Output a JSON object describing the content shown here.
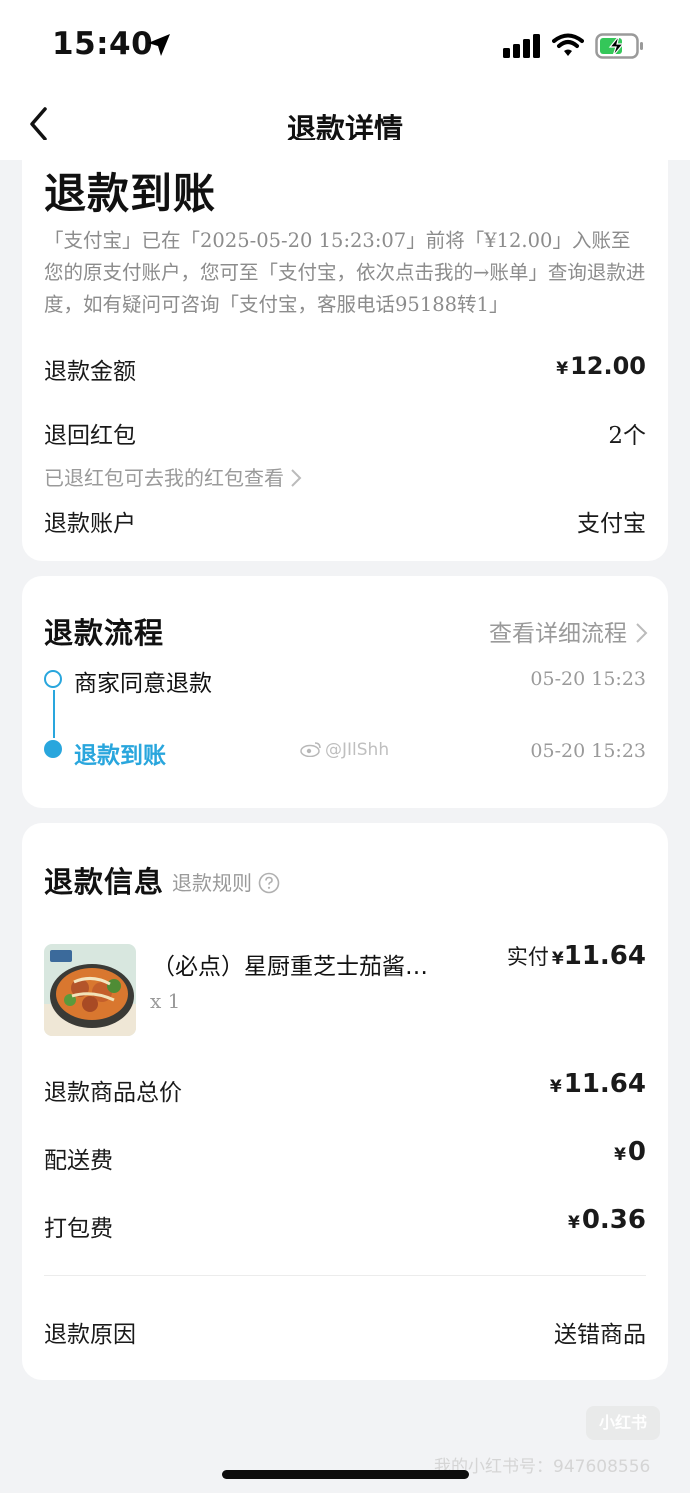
{
  "status_bar": {
    "time": "15:40"
  },
  "nav": {
    "title": "退款详情"
  },
  "summary": {
    "title": "退款到账",
    "notice": "「支付宝」已在「2025-05-20 15:23:07」前将「¥12.00」入账至您的原支付账户，您可至「支付宝，依次点击我的→账单」查询退款进度，如有疑问可咨询「支付宝，客服电话95188转1」",
    "refund_amount_label": "退款金额",
    "refund_amount_currency": "¥",
    "refund_amount_value": "12.00",
    "red_packet_label": "退回红包",
    "red_packet_value": "2个",
    "red_packet_hint": "已退红包可去我的红包查看",
    "account_label": "退款账户",
    "account_value": "支付宝"
  },
  "process": {
    "title": "退款流程",
    "detail_link": "查看详细流程",
    "steps": [
      {
        "label": "商家同意退款",
        "time": "05-20 15:23"
      },
      {
        "label": "退款到账",
        "time": "05-20 15:23"
      }
    ]
  },
  "info": {
    "title": "退款信息",
    "rules_link": "退款规则",
    "item": {
      "name": "（必点）星厨重芝士茄酱…",
      "qty": "x 1",
      "paid_label": "实付",
      "currency": "¥",
      "paid_value": "11.64"
    },
    "rows": [
      {
        "label": "退款商品总价",
        "currency": "¥",
        "value": "11.64"
      },
      {
        "label": "配送费",
        "currency": "¥",
        "value": "0"
      },
      {
        "label": "打包费",
        "currency": "¥",
        "value": "0.36"
      }
    ],
    "reason_label": "退款原因",
    "reason_value": "送错商品"
  },
  "watermarks": {
    "center": "@JIlShh",
    "logo": "小红书",
    "id": "我的小红书号：947608556"
  },
  "colors": {
    "accent": "#29a6dd",
    "background": "#f2f3f5"
  }
}
